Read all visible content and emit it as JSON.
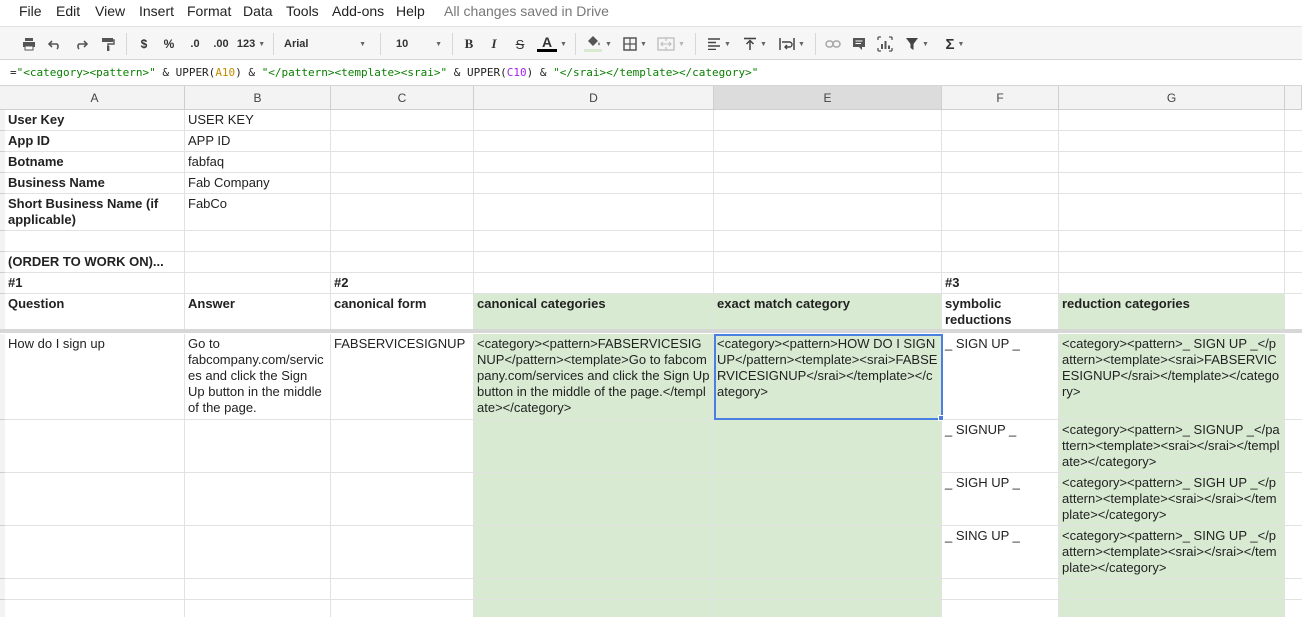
{
  "menu": {
    "items": [
      "File",
      "Edit",
      "View",
      "Insert",
      "Format",
      "Data",
      "Tools",
      "Add-ons",
      "Help"
    ],
    "save_status": "All changes saved in Drive"
  },
  "toolbar": {
    "currency": "$",
    "percent": "%",
    "dec_decrease": ".0",
    "dec_increase": ".00",
    "more_formats": "123",
    "font": "Arial",
    "font_size": "10",
    "bold": "B",
    "italic": "I",
    "strike": "S",
    "text_color_letter": "A",
    "text_color": "#000000"
  },
  "formula_bar": {
    "parts": [
      {
        "t": "=",
        "k": "op"
      },
      {
        "t": "\"<category><pattern>\"",
        "k": "str"
      },
      {
        "t": " & UPPER(",
        "k": "op"
      },
      {
        "t": "A10",
        "k": "refa"
      },
      {
        "t": ") & ",
        "k": "op"
      },
      {
        "t": "\"</pattern><template><srai>\"",
        "k": "str"
      },
      {
        "t": " & UPPER(",
        "k": "op"
      },
      {
        "t": "C10",
        "k": "refc"
      },
      {
        "t": ") & ",
        "k": "op"
      },
      {
        "t": "\"</srai></template></category>\"",
        "k": "str"
      }
    ]
  },
  "columns": [
    "A",
    "B",
    "C",
    "D",
    "E",
    "F",
    "G"
  ],
  "selected_column": "E",
  "colors": {
    "green_fill": "#d9ead3",
    "selection": "#4a7fdf"
  },
  "cells": {
    "r1": {
      "A": "User Key",
      "B": "USER KEY"
    },
    "r2": {
      "A": "App ID",
      "B": "APP ID"
    },
    "r3": {
      "A": "Botname",
      "B": "fabfaq"
    },
    "r4": {
      "A": "Business Name",
      "B": "Fab Company"
    },
    "r5": {
      "A": "Short Business Name (if applicable)",
      "B": "FabCo"
    },
    "r7": {
      "A": "(ORDER TO WORK ON)..."
    },
    "r8": {
      "A": "#1",
      "C": "#2",
      "F": "#3"
    },
    "r9": {
      "A": "Question",
      "B": "Answer",
      "C": "canonical form",
      "D": "canonical categories",
      "E": "exact match category",
      "F": "symbolic reductions",
      "G": "reduction categories"
    },
    "r10": {
      "A": "How do I sign up",
      "B": "Go to fabcompany.com/services and click the Sign Up button in the middle of the page.",
      "C": "FABSERVICESIGNUP",
      "D": "<category><pattern>FABSERVICESIGNUP</pattern><template>Go to fabcompany.com/services and click the Sign Up button in the middle of the page.</template></category>",
      "E": "<category><pattern>HOW DO I SIGN UP</pattern><template><srai>FABSERVICESIGNUP</srai></template></category>",
      "F": "_ SIGN UP _",
      "G": "<category><pattern>_ SIGN UP _</pattern><template><srai>FABSERVICESIGNUP</srai></template></category>"
    },
    "r11": {
      "F": "_ SIGNUP _",
      "G": "<category><pattern>_ SIGNUP _</pattern><template><srai></srai></template></category>"
    },
    "r12": {
      "F": "_ SIGH UP _",
      "G": "<category><pattern>_ SIGH UP _</pattern><template><srai></srai></template></category>"
    },
    "r13": {
      "F": "_ SING UP _",
      "G": "<category><pattern>_ SING UP _</pattern><template><srai></srai></template></category>"
    }
  }
}
